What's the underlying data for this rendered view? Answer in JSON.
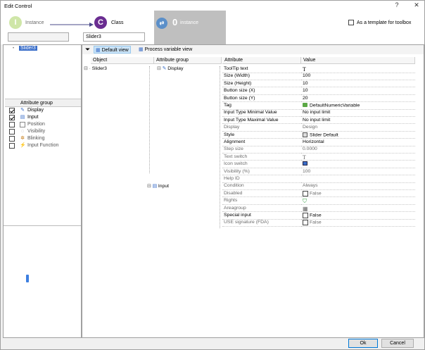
{
  "window": {
    "title": "Edit Control",
    "help": "?",
    "close": "✕"
  },
  "wizard": {
    "instance": {
      "letter": "I",
      "label": "Instance",
      "value": ""
    },
    "class": {
      "letter": "C",
      "label": "Class",
      "value": "Slider3"
    },
    "zero_instance": {
      "count": "0",
      "label": "instance"
    }
  },
  "header": {
    "template_checkbox": "As a template for toolbox"
  },
  "left_tree": {
    "selected": "Slider3"
  },
  "attribute_groups": {
    "header": "Attribute group",
    "items": [
      {
        "label": "Display",
        "checked": true
      },
      {
        "label": "Input",
        "checked": true
      },
      {
        "label": "Position",
        "checked": false
      },
      {
        "label": "Visibility",
        "checked": false
      },
      {
        "label": "Blinking",
        "checked": false
      },
      {
        "label": "Input Function",
        "checked": false
      }
    ]
  },
  "toolbar": {
    "default_view": "Default view",
    "process_view": "Process variable view"
  },
  "columns": {
    "object": "Object",
    "attribute_group": "Attribute group",
    "attribute": "Attribute",
    "value": "Value"
  },
  "objects": [
    {
      "name": "Slider3"
    }
  ],
  "groups": {
    "display": "Display",
    "input": "Input"
  },
  "attributes": [
    {
      "name": "ToolTip text",
      "value": "",
      "icon": "text-T",
      "grey": false
    },
    {
      "name": "Size (Width)",
      "value": "100",
      "icon": "",
      "grey": false
    },
    {
      "name": "Size (Height)",
      "value": "10",
      "icon": "",
      "grey": false
    },
    {
      "name": "Button size (X)",
      "value": "10",
      "icon": "",
      "grey": false
    },
    {
      "name": "Button size (Y)",
      "value": "20",
      "icon": "",
      "grey": false
    },
    {
      "name": "Tag",
      "value": "DefaultNumericVariable",
      "icon": "tag",
      "grey": false
    },
    {
      "name": "Input Type Minimal Value",
      "value": "No input limit",
      "icon": "",
      "grey": false
    },
    {
      "name": "Input Type Maximal Value",
      "value": "No input limit",
      "icon": "",
      "grey": false
    },
    {
      "name": "Display",
      "value": "Design",
      "icon": "",
      "grey": true
    },
    {
      "name": "Style",
      "value": "Slider Default",
      "icon": "style",
      "grey": false
    },
    {
      "name": "Alignment",
      "value": "Horizontal",
      "icon": "",
      "grey": false
    },
    {
      "name": "Step size",
      "value": "0.0000",
      "icon": "",
      "grey": true
    },
    {
      "name": "Text switch",
      "value": "",
      "icon": "text-T",
      "grey": true
    },
    {
      "name": "Icon switch",
      "value": "",
      "icon": "image",
      "grey": true
    },
    {
      "name": "Visibility (%)",
      "value": "100",
      "icon": "",
      "grey": true
    },
    {
      "name": "Help ID",
      "value": "",
      "icon": "",
      "grey": true
    },
    {
      "name": "Condition",
      "value": "Always",
      "icon": "",
      "grey": true
    },
    {
      "name": "Disabled",
      "value": "False",
      "icon": "checkbox",
      "grey": true
    },
    {
      "name": "Rights",
      "value": "",
      "icon": "shield",
      "grey": true
    },
    {
      "name": "Areagroup",
      "value": "",
      "icon": "grid",
      "grey": true
    },
    {
      "name": "Special input",
      "value": "False",
      "icon": "checkbox",
      "grey": false
    },
    {
      "name": "USE signature (FDA)",
      "value": "False",
      "icon": "checkbox",
      "grey": true
    }
  ],
  "footer": {
    "ok": "Ok",
    "cancel": "Cancel"
  }
}
